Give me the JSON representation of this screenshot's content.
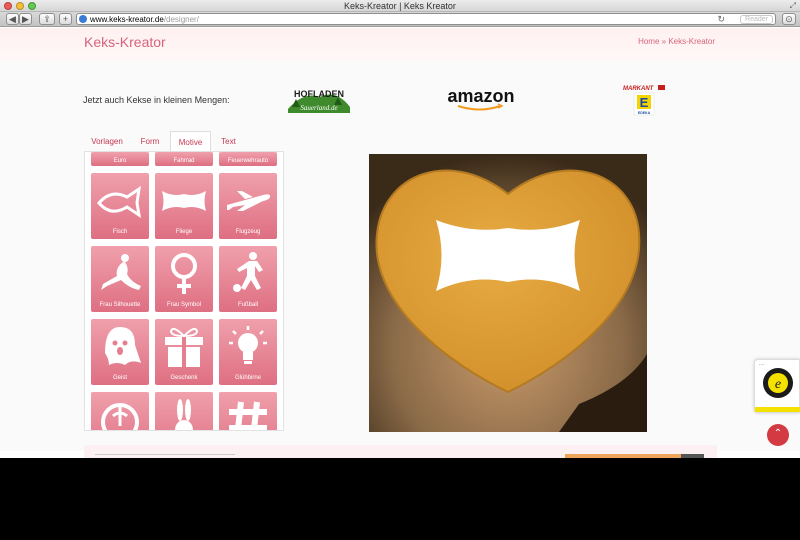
{
  "browser": {
    "title": "Keks-Kreator | Keks Kreator",
    "url_host": "www.keks-kreator.de",
    "url_path": "/designer/",
    "reader": "Reader"
  },
  "header": {
    "brand": "Keks-Kreator",
    "breadcrumb": "Home » Keks-Kreator"
  },
  "promo": {
    "tagline": "Jetzt auch Kekse in kleinen Mengen:",
    "logos": [
      "HOFLADEN",
      "Sauerland.de",
      "amazon",
      "MARKANT",
      "E",
      "EDEKA"
    ]
  },
  "tabs": [
    "Vorlagen",
    "Form",
    "Motive",
    "Text"
  ],
  "active_tab": "Motive",
  "motifs": {
    "top_row": [
      "Euro",
      "Fahrrad",
      "Feuerwehrauto"
    ],
    "tiles": [
      "Fisch",
      "Fliege",
      "Flugzeug",
      "Frau Silhouette",
      "Frau Symbol",
      "Fußball",
      "Geist",
      "Geschenk",
      "Glühbirne",
      "",
      "",
      ""
    ]
  },
  "preview": {
    "shape": "heart",
    "motif": "Fliege"
  },
  "badge": {
    "dots": "....",
    "mark": "e"
  },
  "totop": "⌃",
  "colors": {
    "accent": "#d6657a",
    "tile": "#e57f90",
    "cookie": "#e0a33a"
  }
}
